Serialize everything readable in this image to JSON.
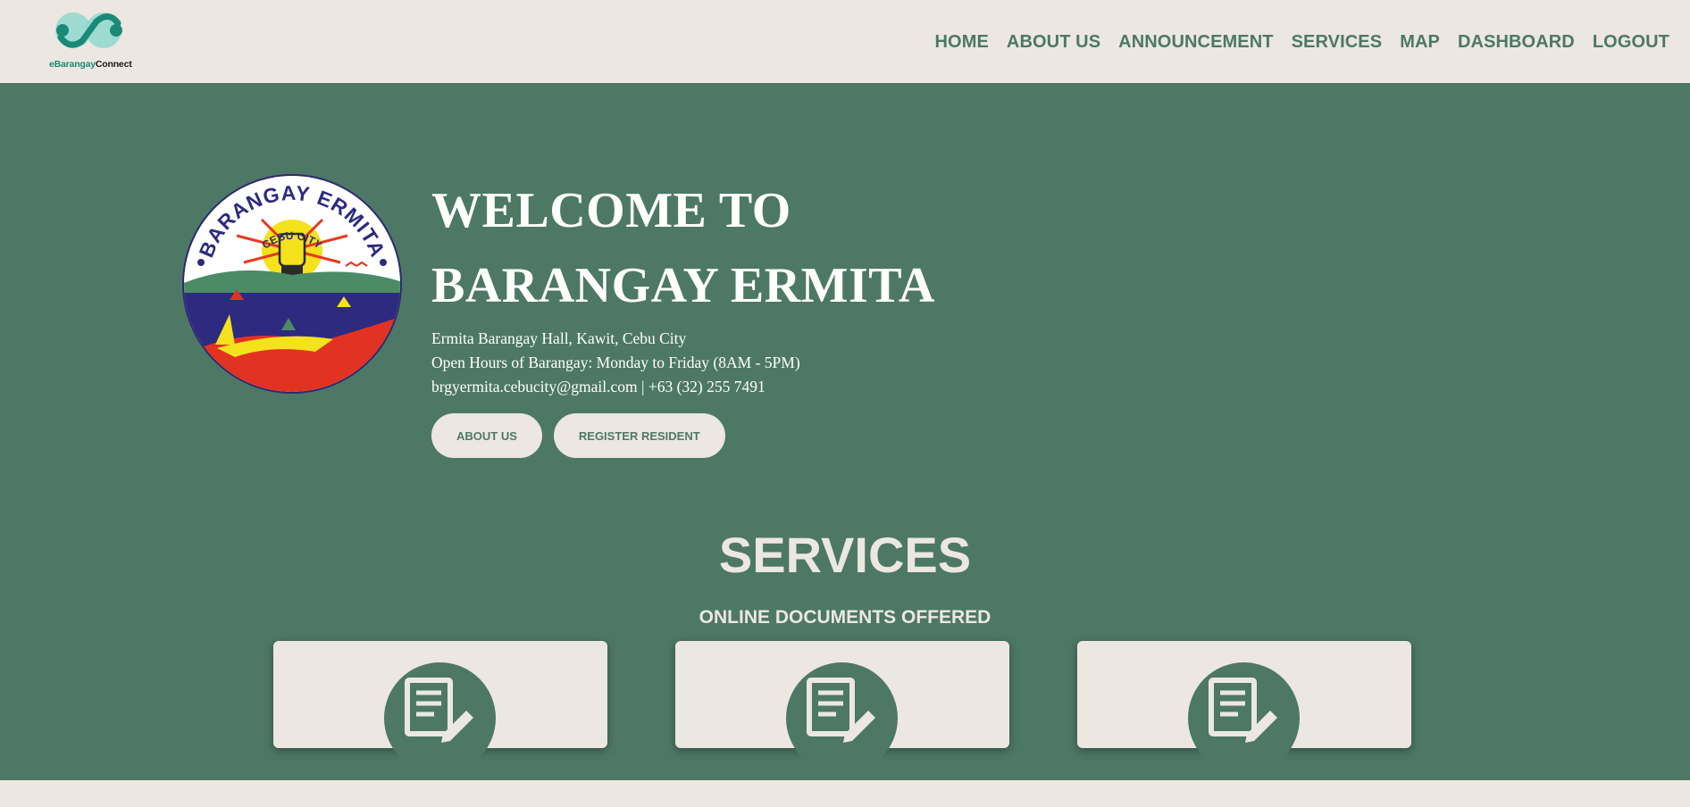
{
  "brand": {
    "name_part1": "eBarangay",
    "name_part2": "Connect",
    "logo_icon": "chain-link-logo",
    "colors": {
      "teal": "#1a8a78",
      "light_teal": "#8fd8cc"
    }
  },
  "nav": {
    "items": [
      {
        "label": "HOME"
      },
      {
        "label": "ABOUT US"
      },
      {
        "label": "ANNOUNCEMENT"
      },
      {
        "label": "SERVICES"
      },
      {
        "label": "MAP"
      },
      {
        "label": "DASHBOARD"
      },
      {
        "label": "LOGOUT"
      }
    ]
  },
  "hero": {
    "seal": {
      "icon": "barangay-ermita-seal",
      "top_text": "BARANGAY ERMITA",
      "inner_text": "CEBU CITY"
    },
    "title_line1": "WELCOME TO",
    "title_line2": "BARANGAY ERMITA",
    "address": "Ermita Barangay Hall, Kawit, Cebu City",
    "hours": "Open Hours of Barangay: Monday to Friday (8AM - 5PM)",
    "contact": "brgyermita.cebucity@gmail.com | +63 (32) 255 7491",
    "buttons": {
      "about": "ABOUT US",
      "register": "REGISTER RESIDENT"
    }
  },
  "services": {
    "title": "SERVICES",
    "subtitle": "ONLINE DOCUMENTS OFFERED",
    "cards": [
      {
        "icon": "document-edit-icon"
      },
      {
        "icon": "document-edit-icon"
      },
      {
        "icon": "document-edit-icon"
      }
    ]
  },
  "colors": {
    "primary_green": "#4d7866",
    "background_beige": "#ece7e1",
    "white": "#ffffff"
  }
}
